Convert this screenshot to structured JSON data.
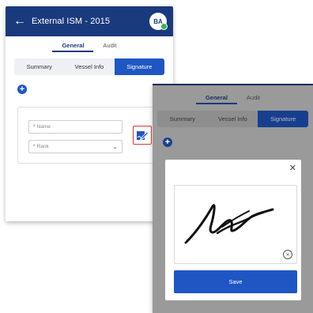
{
  "header": {
    "title": "External ISM - 2015",
    "avatar_initials": "BA"
  },
  "top_tabs": [
    {
      "label": "General",
      "active": true
    },
    {
      "label": "Audit",
      "active": false
    }
  ],
  "segments": [
    {
      "label": "Summary",
      "active": false
    },
    {
      "label": "Vessel Info",
      "active": false
    },
    {
      "label": "Signature",
      "active": true
    }
  ],
  "form": {
    "name_placeholder": "Name",
    "rank_placeholder": "Rank",
    "required_mark": "*"
  },
  "modal": {
    "save_label": "Save"
  },
  "icons": {
    "back": "arrow-left-icon",
    "add": "plus-icon",
    "sign": "signature-pen-icon",
    "close": "close-icon",
    "clear": "clear-signature-icon",
    "dropdown": "chevron-down-icon"
  },
  "colors": {
    "primary": "#1a3a7e",
    "accent": "#1f56c4",
    "highlight_border": "#d23b3b",
    "status_dot": "#3cb44b"
  }
}
